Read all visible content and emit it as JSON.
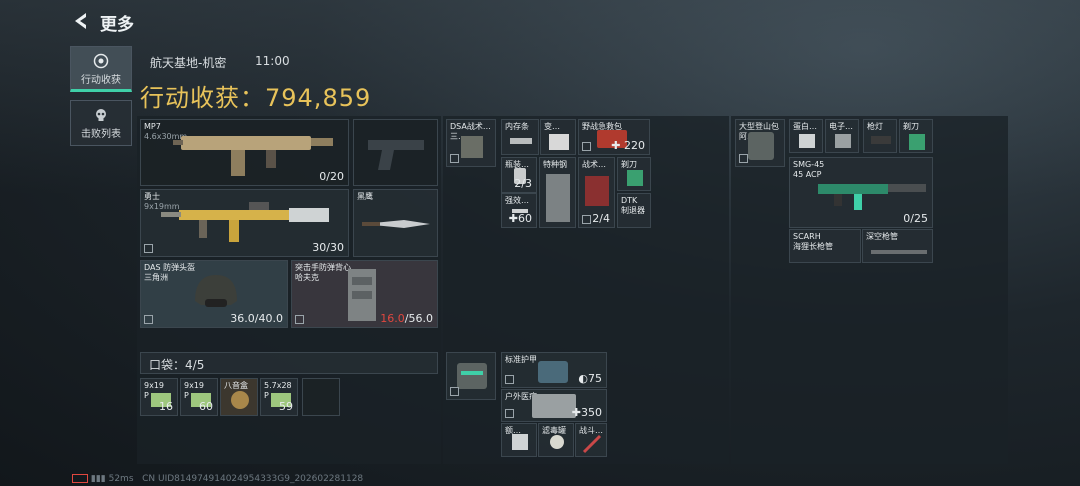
{
  "header": {
    "title": "更多"
  },
  "tabs": [
    {
      "label": "行动收获",
      "active": true
    },
    {
      "label": "击败列表",
      "active": false
    }
  ],
  "map": {
    "name": "航天基地-机密",
    "time": "11:00"
  },
  "income": {
    "label": "行动收获：",
    "value": "794,859"
  },
  "loadout": {
    "primary": {
      "name": "MP7",
      "caliber": "4.6x30mm",
      "ammo": "0/20"
    },
    "secondary": {
      "name": "勇士",
      "caliber": "9x19mm",
      "ammo": "30/30"
    },
    "melee": {
      "name": "黑鹰"
    },
    "helmet": {
      "name": "DAS 防弹头盔",
      "sub": "三角洲",
      "durability": "36.0/40.0"
    },
    "armor": {
      "name": "突击手防弹背心",
      "sub": "哈夫克",
      "durability_current": "16.0",
      "durability_max": "/56.0"
    }
  },
  "pocket": {
    "label": "口袋：",
    "value": "4/5",
    "items": [
      {
        "name": "9x19",
        "sub": "P",
        "count": "16"
      },
      {
        "name": "9x19",
        "sub": "P",
        "count": "60"
      },
      {
        "name": "八音盒",
        "count": ""
      },
      {
        "name": "5.7x28",
        "sub": "P",
        "count": "59"
      }
    ]
  },
  "chest_rig": {
    "name": "DSA战术…",
    "sub": "三…"
  },
  "rig_items": [
    {
      "name": "内存条",
      "count": ""
    },
    {
      "name": "变…",
      "count": ""
    },
    {
      "name": "野战急救包",
      "count": "220"
    },
    {
      "name": "瓶装…",
      "count": "2/3"
    },
    {
      "name": "强效…",
      "count": "60"
    },
    {
      "name": "特种钢",
      "count": ""
    },
    {
      "name": "战术…",
      "count": "2/4"
    },
    {
      "name": "剃刀",
      "count": ""
    },
    {
      "name": "DTK",
      "sub": "制退器",
      "count": ""
    }
  ],
  "backpack_small": {
    "name": ""
  },
  "backpack_items": [
    {
      "name": "标准护甲",
      "count": "75"
    },
    {
      "name": "户外医疗…",
      "count": "350"
    },
    {
      "name": "额…",
      "count": ""
    },
    {
      "name": "滤毒罐",
      "count": ""
    },
    {
      "name": "战斗…",
      "count": ""
    }
  ],
  "right": {
    "bag": {
      "name": "大型登山包",
      "sub": "阿…"
    },
    "items": [
      {
        "name": "蛋白…"
      },
      {
        "name": "电子…"
      },
      {
        "name": "枪灯"
      },
      {
        "name": "剃刀"
      }
    ],
    "weapon": {
      "name": "SMG-45",
      "caliber": "45 ACP",
      "ammo": "0/25"
    },
    "parts": [
      {
        "name": "SCARH",
        "sub": "海狸长枪管"
      },
      {
        "name": "深空枪管"
      }
    ]
  },
  "footer": {
    "ping": "52ms",
    "uid": "CN UID814974914024954333G9_202602281128"
  }
}
